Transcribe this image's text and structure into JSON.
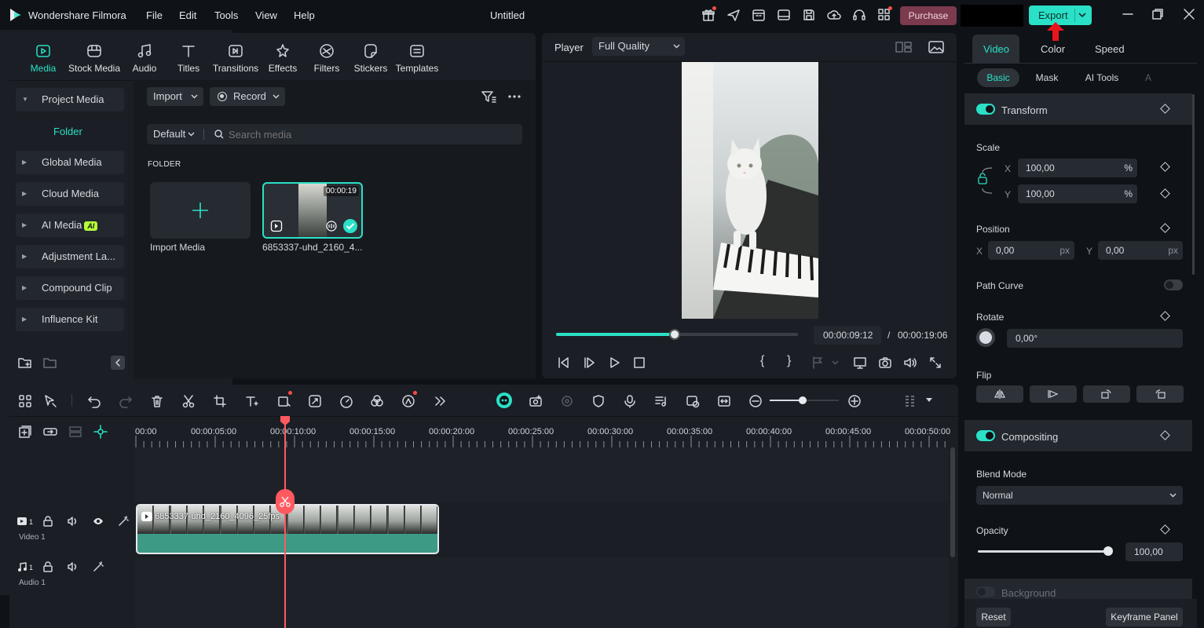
{
  "app": {
    "name": "Wondershare Filmora",
    "title": "Untitled",
    "menu": [
      "File",
      "Edit",
      "Tools",
      "View",
      "Help"
    ],
    "purchase": "Purchase",
    "export": "Export"
  },
  "media_tabs": [
    {
      "label": "Media",
      "icon": "media-icon",
      "active": true
    },
    {
      "label": "Stock Media",
      "icon": "stock-media-icon"
    },
    {
      "label": "Audio",
      "icon": "audio-icon"
    },
    {
      "label": "Titles",
      "icon": "titles-icon"
    },
    {
      "label": "Transitions",
      "icon": "transitions-icon"
    },
    {
      "label": "Effects",
      "icon": "effects-icon"
    },
    {
      "label": "Filters",
      "icon": "filters-icon"
    },
    {
      "label": "Stickers",
      "icon": "stickers-icon"
    },
    {
      "label": "Templates",
      "icon": "templates-icon"
    }
  ],
  "sidebar": {
    "items": [
      {
        "label": "Project Media",
        "expanded": true
      },
      {
        "label": "Folder",
        "sub": true
      },
      {
        "label": "Global Media"
      },
      {
        "label": "Cloud Media"
      },
      {
        "label": "AI Media",
        "badge": "AI"
      },
      {
        "label": "Adjustment La..."
      },
      {
        "label": "Compound Clip"
      },
      {
        "label": "Influence Kit"
      }
    ]
  },
  "media_toolbar": {
    "import": "Import",
    "record": "Record",
    "sort": "Default",
    "search_placeholder": "Search media"
  },
  "folder": {
    "heading": "FOLDER",
    "items": [
      {
        "label": "Import Media",
        "type": "import"
      },
      {
        "label": "6853337-uhd_2160_4...",
        "duration": "00:00:19",
        "selected": true
      }
    ]
  },
  "player": {
    "label": "Player",
    "quality": "Full Quality",
    "current_time": "00:00:09:12",
    "separator": "/",
    "total_time": "00:00:19:06",
    "progress": 0.49
  },
  "properties": {
    "tabs": [
      "Video",
      "Color",
      "Speed"
    ],
    "subtabs": [
      "Basic",
      "Mask",
      "AI Tools",
      "A"
    ],
    "transform": {
      "title": "Transform",
      "scale_label": "Scale",
      "scale_x": "100,00",
      "scale_y": "100,00",
      "unit_pct": "%",
      "x": "X",
      "y": "Y",
      "position_label": "Position",
      "pos_x": "0,00",
      "pos_y": "0,00",
      "unit_px": "px",
      "path_curve": "Path Curve",
      "rotate_label": "Rotate",
      "rotate_value": "0,00°",
      "flip_label": "Flip"
    },
    "compositing": {
      "title": "Compositing",
      "blend_label": "Blend Mode",
      "blend_value": "Normal",
      "opacity_label": "Opacity",
      "opacity_value": "100,00",
      "opacity": 1.0
    },
    "background": {
      "title": "Background"
    },
    "reset": "Reset",
    "keyframe_panel": "Keyframe Panel"
  },
  "timeline": {
    "ruler": [
      "00:00",
      "00:00:05:00",
      "00:00:10:00",
      "00:00:15:00",
      "00:00:20:00",
      "00:00:25:00",
      "00:00:30:00",
      "00:00:35:00",
      "00:00:40:00",
      "00:00:45:00",
      "00:00:50:00"
    ],
    "tracks": [
      {
        "name": "Video 1",
        "num": "1"
      },
      {
        "name": "Audio 1",
        "num": "1"
      }
    ],
    "clip_label": "6853337-uhd_2160_4096_25fps"
  },
  "colors": {
    "accent": "#2ae0c6",
    "playhead": "#ff5a5f",
    "purchase": "#7b3a4d"
  }
}
